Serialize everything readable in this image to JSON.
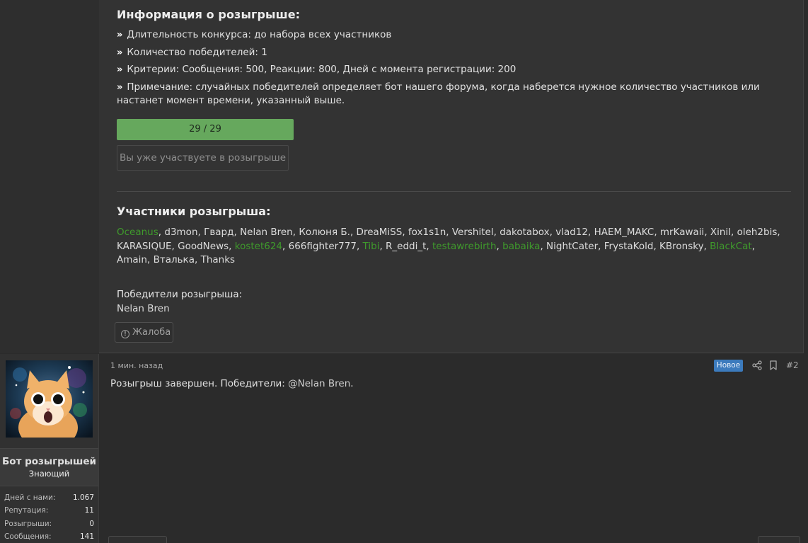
{
  "giveaway": {
    "info_title": "Информация о розыгрыше:",
    "bullets": [
      "Длительность конкурса: до набора всех участников",
      "Количество победителей: 1",
      "Критерии: Сообщения: 500, Реакции: 800, Дней с момента регистрации: 200",
      "Примечание: случайных победителей определяет бот нашего форума, когда наберется нужное количество участников или настанет момент времени, указанный выше."
    ],
    "bullet_glyph": "»",
    "progress": {
      "label": "29 / 29",
      "current": 29,
      "total": 29
    },
    "joined_label": "Вы уже участвуете в розыгрыше",
    "participants_title": "Участники розыгрыша:",
    "participants": [
      {
        "name": "Oceanus",
        "green": true
      },
      {
        "name": "d3mon",
        "green": false
      },
      {
        "name": "Гвард",
        "green": false
      },
      {
        "name": "Nelan Bren",
        "green": false
      },
      {
        "name": "Колюня Б.",
        "green": false
      },
      {
        "name": "DreaMiSS",
        "green": false
      },
      {
        "name": "fox1s1n",
        "green": false
      },
      {
        "name": "Vershitel",
        "green": false
      },
      {
        "name": "dakotabox",
        "green": false
      },
      {
        "name": "vlad12",
        "green": false
      },
      {
        "name": "HAEM_MAKC",
        "green": false
      },
      {
        "name": "mrKawaii",
        "green": false
      },
      {
        "name": "Xinil",
        "green": false
      },
      {
        "name": "oleh2bis",
        "green": false
      },
      {
        "name": "KARASIQUE",
        "green": false
      },
      {
        "name": "GoodNews",
        "green": false
      },
      {
        "name": "kostet624",
        "green": true
      },
      {
        "name": "666fighter777",
        "green": false
      },
      {
        "name": "Tibi",
        "green": true
      },
      {
        "name": "R_eddi_t",
        "green": false
      },
      {
        "name": "testawrebirth",
        "green": true
      },
      {
        "name": "babaika",
        "green": true
      },
      {
        "name": "NightCater",
        "green": false
      },
      {
        "name": "FrystaKold",
        "green": false
      },
      {
        "name": "KBronsky",
        "green": false
      },
      {
        "name": "BlackCat",
        "green": true
      },
      {
        "name": "Amain",
        "green": false
      },
      {
        "name": "Вталька",
        "green": false
      },
      {
        "name": "Thanks",
        "green": false
      }
    ],
    "winners_label": "Победители розыгрыша:",
    "winner_name": "Nelan Bren",
    "report_label": "Жалоба",
    "report_icon": "exclamation-circle-icon"
  },
  "post2": {
    "author": "Бот розыгрышей",
    "user_title": "Знающий",
    "stats": [
      {
        "label": "Дней с нами:",
        "value": "1.067"
      },
      {
        "label": "Репутация:",
        "value": "11"
      },
      {
        "label": "Розыгрыши:",
        "value": "0"
      },
      {
        "label": "Сообщения:",
        "value": "141"
      }
    ],
    "timestamp": "1 мин. назад",
    "badge": "Новое",
    "post_number": "#2",
    "text_prefix": "Розыгрыш завершен. Победители: ",
    "mention": "@Nelan Bren",
    "text_suffix": ".",
    "icons": [
      "share-icon",
      "bookmark-icon"
    ]
  },
  "colors": {
    "background": "#2b2b2b",
    "panel": "#333333",
    "progress": "#66a85d",
    "participant_green": "#3f9a2c",
    "badge_blue": "#3c7bbd"
  }
}
